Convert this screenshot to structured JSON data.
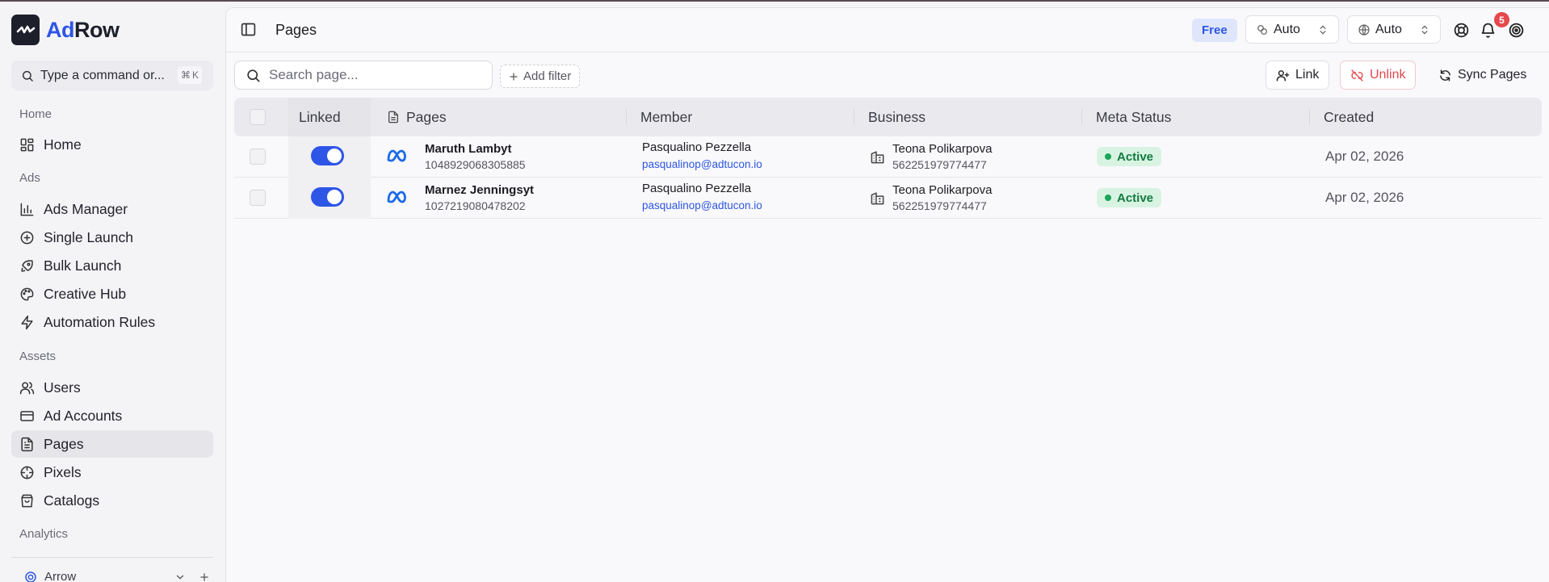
{
  "app": {
    "brand_a": "Ad",
    "brand_b": "Row"
  },
  "command": {
    "placeholder": "Type a command or...",
    "shortcut_symbol": "⌘",
    "shortcut_key": "K"
  },
  "sidebar": {
    "sections": {
      "home": "Home",
      "ads": "Ads",
      "assets": "Assets",
      "analytics": "Analytics"
    },
    "items": [
      {
        "label": "Home",
        "icon": "grid-icon"
      },
      {
        "label": "Ads Manager",
        "icon": "bar-chart-icon"
      },
      {
        "label": "Single Launch",
        "icon": "plus-circle-icon"
      },
      {
        "label": "Bulk Launch",
        "icon": "rocket-icon"
      },
      {
        "label": "Creative Hub",
        "icon": "palette-icon"
      },
      {
        "label": "Automation Rules",
        "icon": "bolt-icon"
      },
      {
        "label": "Users",
        "icon": "users-icon"
      },
      {
        "label": "Ad Accounts",
        "icon": "card-icon"
      },
      {
        "label": "Pages",
        "icon": "file-icon",
        "active": true
      },
      {
        "label": "Pixels",
        "icon": "crosshair-icon"
      },
      {
        "label": "Catalogs",
        "icon": "bag-icon"
      }
    ],
    "workspace": "Arrow"
  },
  "header": {
    "title": "Pages",
    "plan_badge": "Free",
    "theme_select": "Auto",
    "language_select": "Auto",
    "notification_count": "5"
  },
  "toolbar": {
    "search_placeholder": "Search page...",
    "add_filter": "Add filter",
    "link": "Link",
    "unlink": "Unlink",
    "sync": "Sync Pages"
  },
  "table": {
    "columns": {
      "linked": "Linked",
      "pages": "Pages",
      "member": "Member",
      "business": "Business",
      "meta_status": "Meta Status",
      "created": "Created"
    },
    "rows": [
      {
        "linked": true,
        "page_name": "Maruth Lambyt",
        "page_id": "1048929068305885",
        "member_name": "Pasqualino Pezzella",
        "member_email": "pasqualinop@adtucon.io",
        "business_name": "Teona Polikarpova",
        "business_id": "562251979774477",
        "status": "Active",
        "created": "Apr 02, 2026"
      },
      {
        "linked": true,
        "page_name": "Marnez Jenningsyt",
        "page_id": "1027219080478202",
        "member_name": "Pasqualino Pezzella",
        "member_email": "pasqualinop@adtucon.io",
        "business_name": "Teona Polikarpova",
        "business_id": "562251979774477",
        "status": "Active",
        "created": "Apr 02, 2026"
      }
    ]
  },
  "colors": {
    "accent": "#2d55e6",
    "danger": "#e5484d",
    "success": "#1aa756"
  }
}
